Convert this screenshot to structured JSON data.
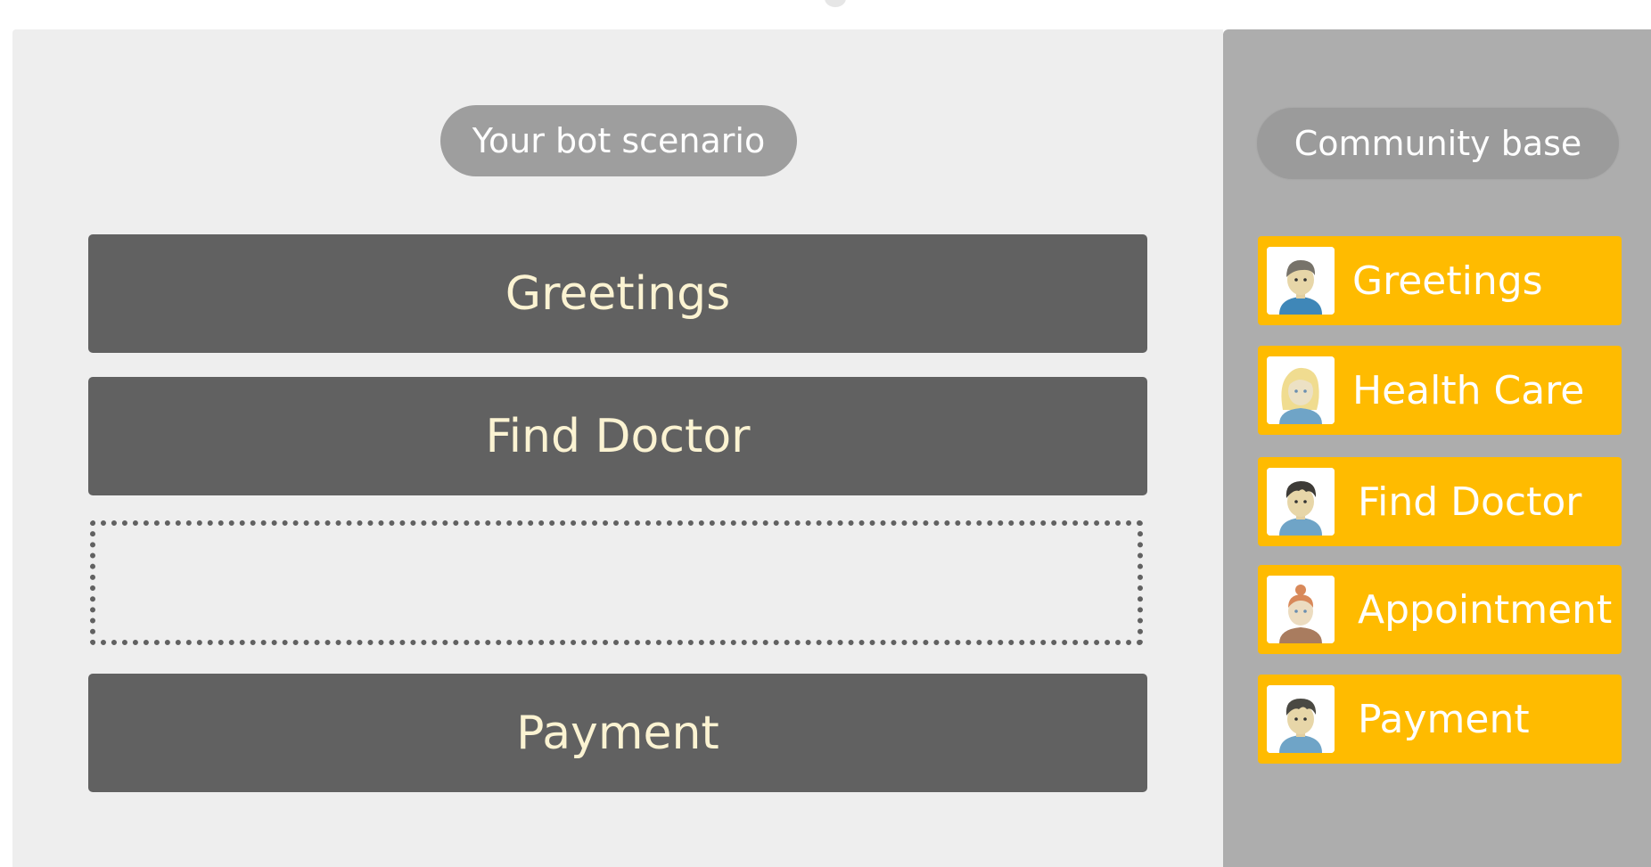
{
  "scenario": {
    "title": "Your bot scenario",
    "blocks": [
      {
        "label": "Greetings"
      },
      {
        "label": "Find Doctor"
      },
      {
        "label": ""
      },
      {
        "label": "Payment"
      }
    ]
  },
  "community": {
    "title": "Community base",
    "items": [
      {
        "label": "Greetings",
        "avatar": "male-avatar-icon"
      },
      {
        "label": "Health Care",
        "avatar": "female-blonde-avatar-icon"
      },
      {
        "label": "Find Doctor",
        "avatar": "male-dark-hair-avatar-icon"
      },
      {
        "label": "Appointment",
        "avatar": "female-redhead-avatar-icon"
      },
      {
        "label": "Payment",
        "avatar": "male-avatar-icon"
      }
    ]
  },
  "colors": {
    "scenario_bg": "#eeeeee",
    "community_bg": "#adadad",
    "block_bg": "#616161",
    "block_text": "#fbf3d2",
    "card_bg": "#ffbb00",
    "pill_bg": "#9e9e9e"
  }
}
